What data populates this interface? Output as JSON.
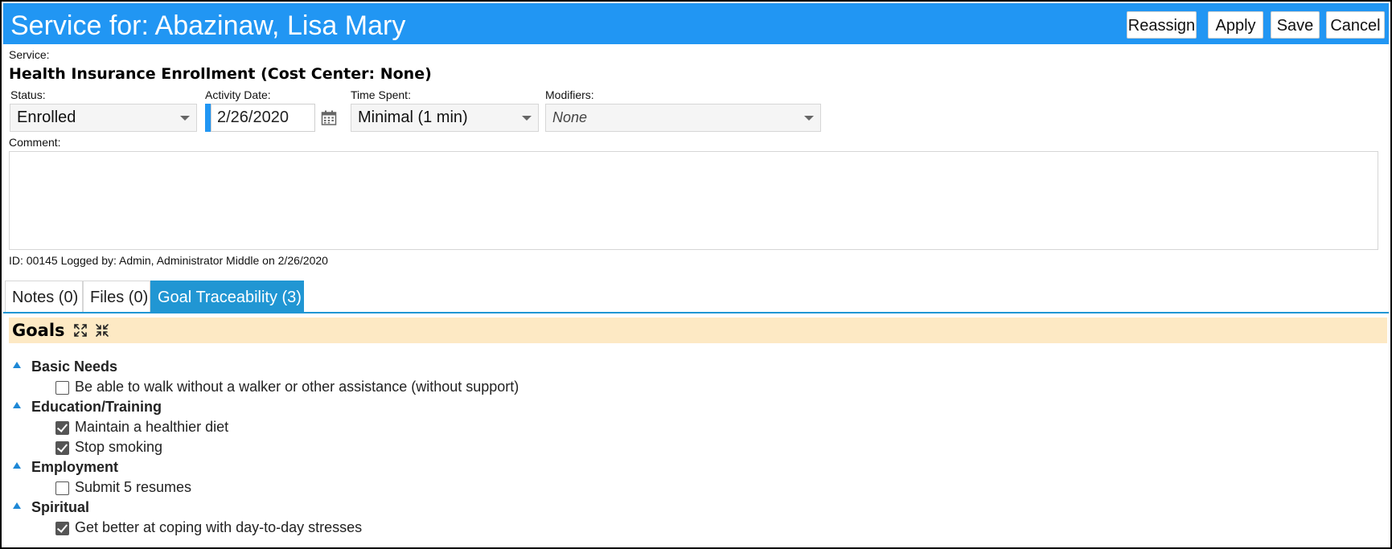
{
  "header": {
    "title": "Service for: Abazinaw, Lisa Mary",
    "buttons": {
      "reassign": "Reassign",
      "apply": "Apply",
      "save": "Save",
      "cancel": "Cancel"
    }
  },
  "service": {
    "label": "Service:",
    "name": "Health Insurance Enrollment (Cost Center: None)"
  },
  "fields": {
    "status": {
      "label": "Status:",
      "value": "Enrolled"
    },
    "activity_date": {
      "label": "Activity Date:",
      "value": "2/26/2020"
    },
    "time_spent": {
      "label": "Time Spent:",
      "value": "Minimal (1 min)"
    },
    "modifiers": {
      "label": "Modifiers:",
      "value": "None"
    },
    "comment": {
      "label": "Comment:",
      "value": ""
    }
  },
  "log_info": "ID: 00145 Logged by: Admin, Administrator Middle on 2/26/2020",
  "tabs": [
    {
      "label": "Notes (0)",
      "active": false
    },
    {
      "label": "Files (0)",
      "active": false
    },
    {
      "label": "Goal Traceability (3)",
      "active": true
    }
  ],
  "goals": {
    "title": "Goals",
    "categories": [
      {
        "name": "Basic Needs",
        "items": [
          {
            "label": "Be able to walk without a walker or other assistance (without support)",
            "checked": false
          }
        ]
      },
      {
        "name": "Education/Training",
        "items": [
          {
            "label": "Maintain a healthier diet",
            "checked": true
          },
          {
            "label": "Stop smoking",
            "checked": true
          }
        ]
      },
      {
        "name": "Employment",
        "items": [
          {
            "label": "Submit 5 resumes",
            "checked": false
          }
        ]
      },
      {
        "name": "Spiritual",
        "items": [
          {
            "label": "Get better at coping with day-to-day stresses",
            "checked": true
          }
        ]
      }
    ]
  },
  "colors": {
    "header_bg": "#2196f3",
    "active_tab": "#2196d3",
    "goals_bar": "#fde9c4",
    "tree_arrow": "#1e88d6"
  },
  "icons": {
    "calendar": "calendar-icon",
    "expand_all": "expand-all-icon",
    "collapse_all": "collapse-all-icon",
    "dropdown": "chevron-down-icon",
    "tree": "tree-expanded-icon"
  }
}
